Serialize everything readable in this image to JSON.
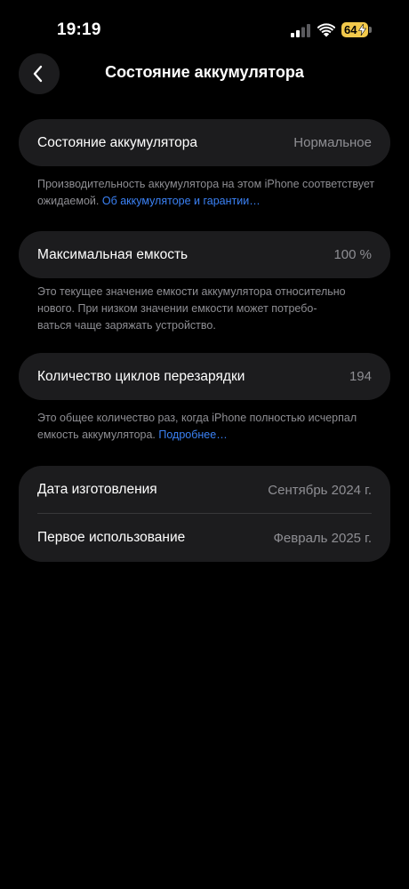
{
  "status_bar": {
    "time": "19:19",
    "battery_level": "64",
    "battery_color": "#f2c94c"
  },
  "nav": {
    "back_icon": "chevron-left-icon",
    "title": "Состояние аккумулятора"
  },
  "battery_health": {
    "label": "Состояние аккумулятора",
    "value": "Нормальное",
    "footnote": "Производительность аккумулятора на этом iPhone соответствует ожидаемой.",
    "link": "Об аккумуляторе и гарантии…"
  },
  "max_capacity": {
    "label": "Максимальная емкость",
    "value": "100 %",
    "footnote_line1": "Это текущее значение емкости аккумулятора относительно",
    "footnote_line2": "нового. При низком значении емкости может потребо-",
    "footnote_line3": "ваться чаще заряжать устройство."
  },
  "cycle_count": {
    "label": "Количество циклов перезарядки",
    "value": "194",
    "footnote": "Это общее количество раз, когда iPhone полностью исчерпал емкость аккумулятора.",
    "link": "Подробнее…"
  },
  "dates": {
    "manufacture_label": "Дата изготовления",
    "manufacture_value": "Сентябрь 2024 г.",
    "first_use_label": "Первое использование",
    "first_use_value": "Февраль 2025 г."
  },
  "colors": {
    "background": "#000000",
    "card": "#1c1c1e",
    "secondary_text": "#8e8e93",
    "link": "#3b82f6"
  }
}
